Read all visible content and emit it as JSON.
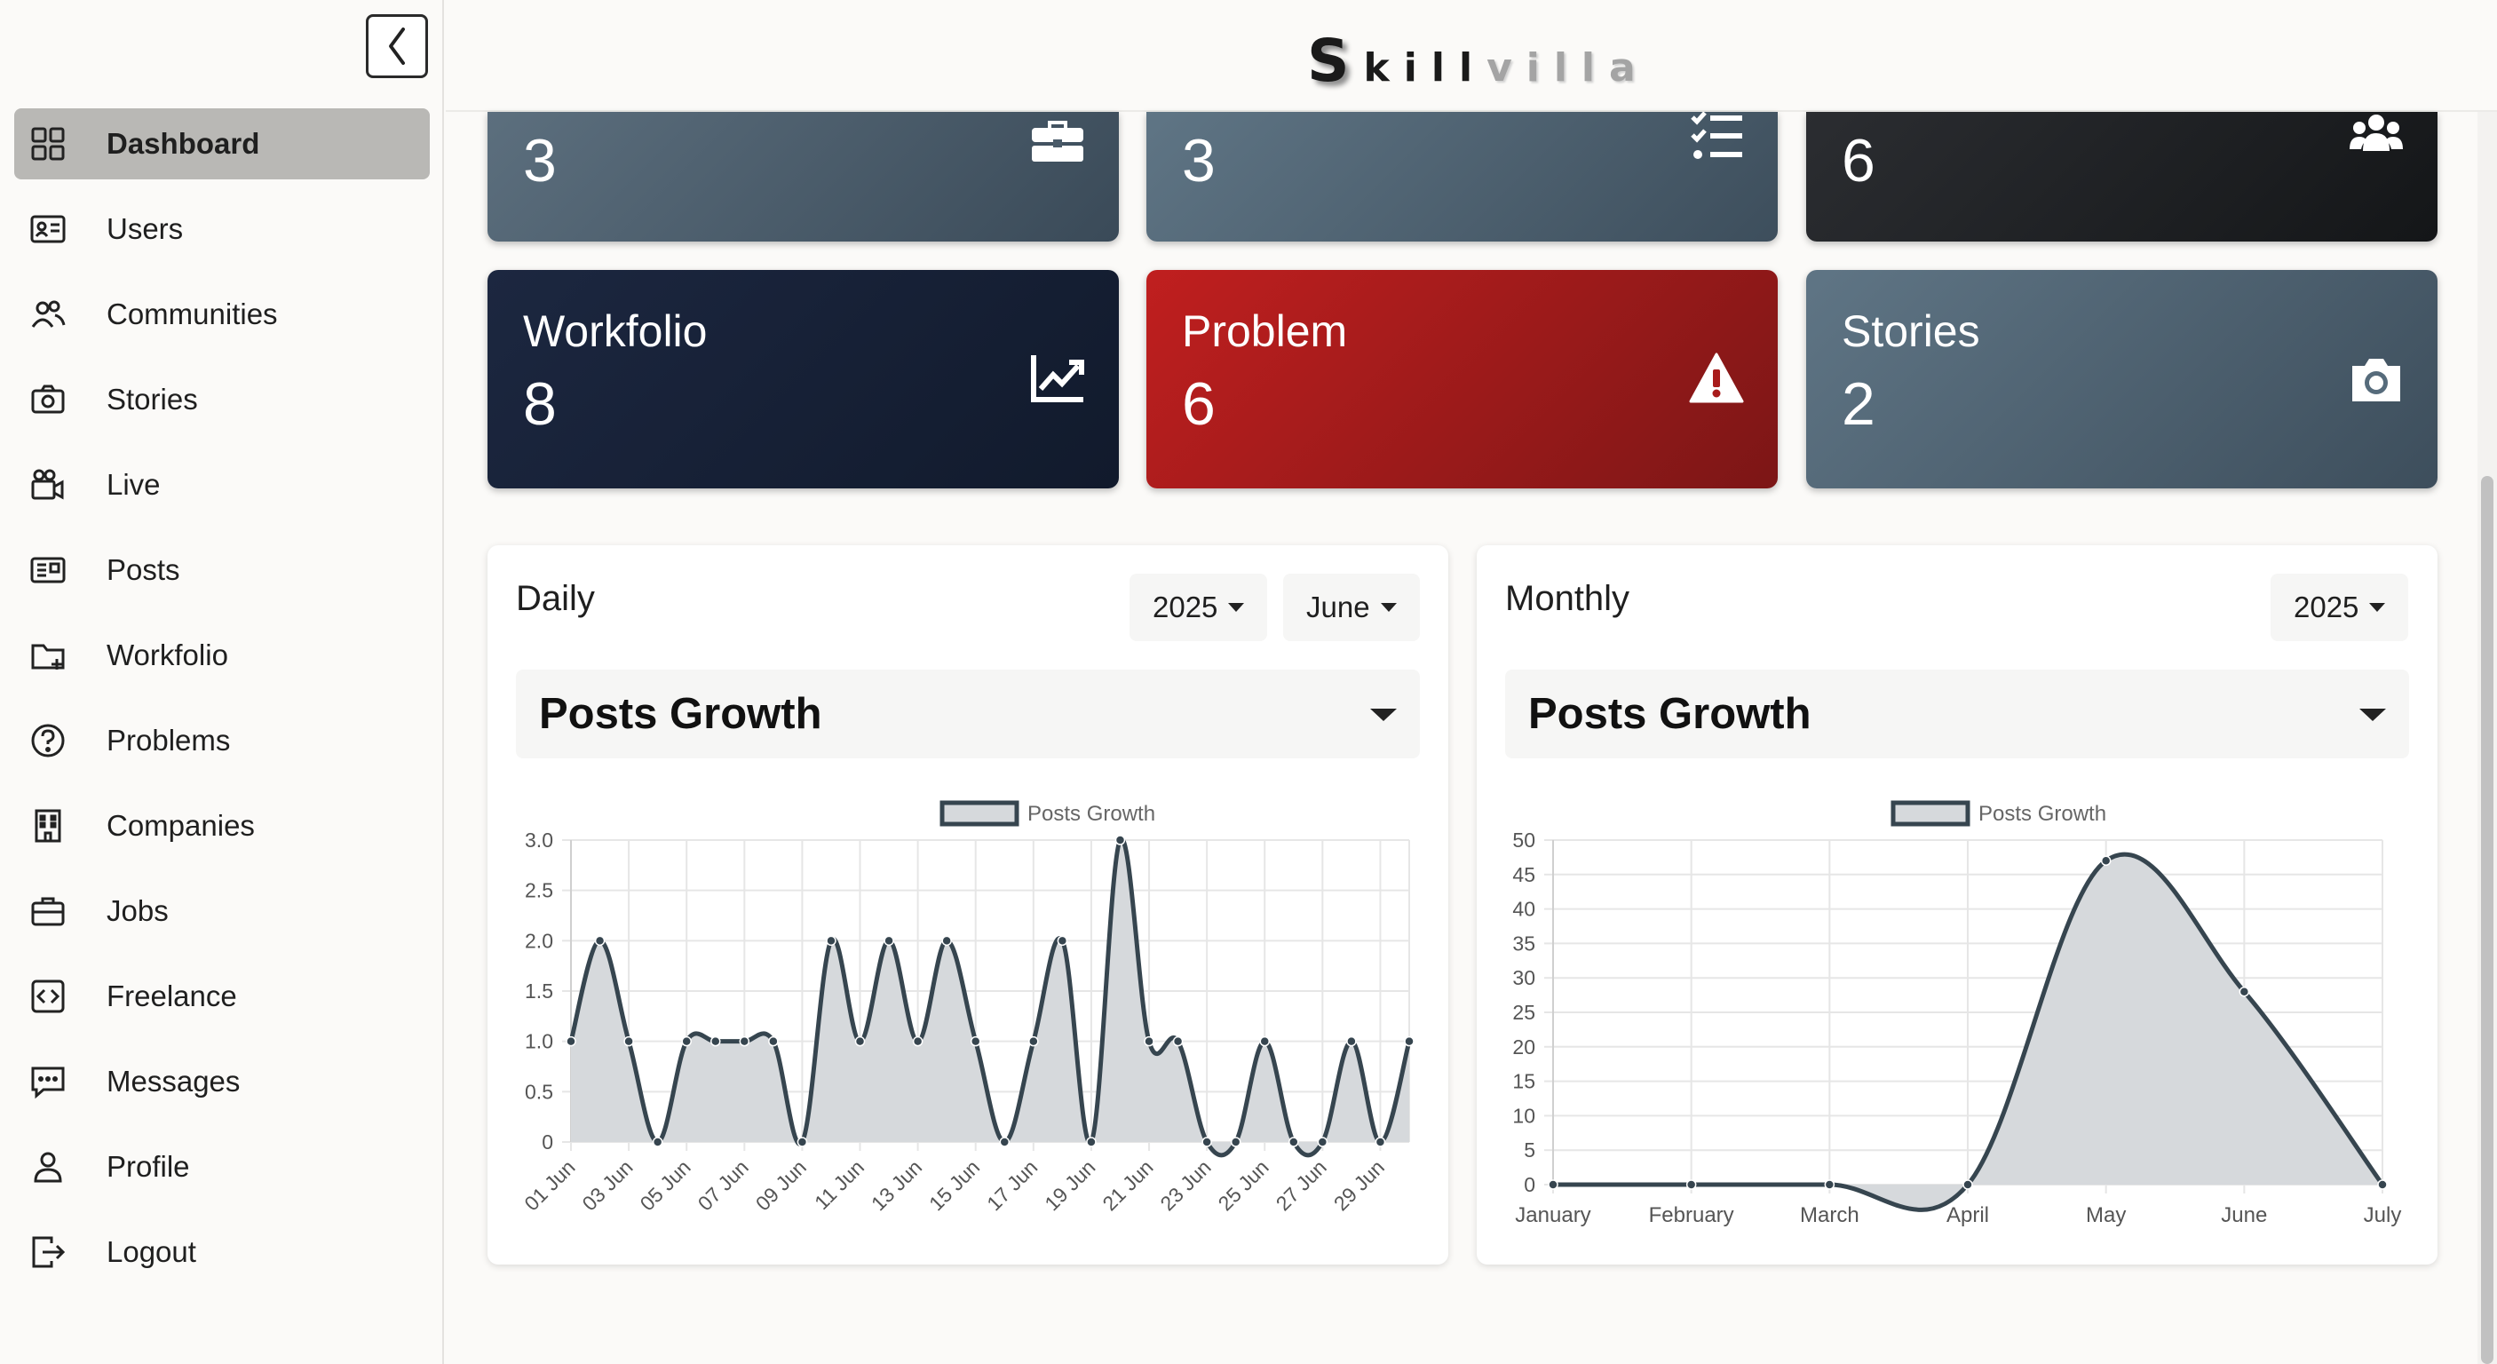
{
  "brand": {
    "initial": "S",
    "dark_part": "kill",
    "light_part": "villa"
  },
  "sidebar": {
    "items": [
      {
        "label": "Dashboard",
        "icon": "dashboard-icon",
        "active": true
      },
      {
        "label": "Users",
        "icon": "users-id-card-icon"
      },
      {
        "label": "Communities",
        "icon": "communities-icon"
      },
      {
        "label": "Stories",
        "icon": "camera-icon"
      },
      {
        "label": "Live",
        "icon": "video-camera-icon"
      },
      {
        "label": "Posts",
        "icon": "posts-icon"
      },
      {
        "label": "Workfolio",
        "icon": "folder-plus-icon"
      },
      {
        "label": "Problems",
        "icon": "question-circle-icon"
      },
      {
        "label": "Companies",
        "icon": "building-icon"
      },
      {
        "label": "Jobs",
        "icon": "briefcase-icon"
      },
      {
        "label": "Freelance",
        "icon": "code-icon"
      },
      {
        "label": "Messages",
        "icon": "message-icon"
      },
      {
        "label": "Profile",
        "icon": "person-icon"
      },
      {
        "label": "Logout",
        "icon": "logout-icon"
      }
    ]
  },
  "cards": {
    "top": [
      {
        "value": "3",
        "icon": "briefcase-icon"
      },
      {
        "value": "3",
        "icon": "checklist-icon"
      },
      {
        "value": "6",
        "icon": "users-group-icon"
      }
    ],
    "bottom": [
      {
        "label": "Workfolio",
        "value": "8",
        "icon": "chart-line-icon"
      },
      {
        "label": "Problem",
        "value": "6",
        "icon": "warning-icon"
      },
      {
        "label": "Stories",
        "value": "2",
        "icon": "camera-icon"
      }
    ]
  },
  "daily": {
    "title": "Daily",
    "year": "2025",
    "month": "June",
    "metric": "Posts Growth"
  },
  "monthly": {
    "title": "Monthly",
    "year": "2025",
    "metric": "Posts Growth"
  },
  "colors": {
    "series_line": "#36454f",
    "series_fill": "#d6d9dc",
    "grid": "#e6e6e6"
  },
  "chart_data": [
    {
      "type": "area",
      "legend": "Posts Growth",
      "x": [
        "01 Jun",
        "02 Jun",
        "03 Jun",
        "04 Jun",
        "05 Jun",
        "06 Jun",
        "07 Jun",
        "08 Jun",
        "09 Jun",
        "10 Jun",
        "11 Jun",
        "12 Jun",
        "13 Jun",
        "14 Jun",
        "15 Jun",
        "16 Jun",
        "17 Jun",
        "18 Jun",
        "19 Jun",
        "20 Jun",
        "21 Jun",
        "22 Jun",
        "23 Jun",
        "24 Jun",
        "25 Jun",
        "26 Jun",
        "27 Jun",
        "28 Jun",
        "29 Jun",
        "30 Jun"
      ],
      "tick_labels": [
        "01 Jun",
        "03 Jun",
        "05 Jun",
        "07 Jun",
        "09 Jun",
        "11 Jun",
        "13 Jun",
        "15 Jun",
        "17 Jun",
        "19 Jun",
        "21 Jun",
        "23 Jun",
        "25 Jun",
        "27 Jun",
        "29 Jun"
      ],
      "series": [
        {
          "name": "Posts Growth",
          "values": [
            1,
            2,
            1,
            0,
            1,
            1,
            1,
            1,
            0,
            2,
            1,
            2,
            1,
            2,
            1,
            0,
            1,
            2,
            0,
            3,
            1,
            1,
            0,
            0,
            1,
            0,
            0,
            1,
            0,
            1
          ]
        }
      ],
      "y_ticks": [
        "0",
        "0.5",
        "1.0",
        "1.5",
        "2.0",
        "2.5",
        "3.0"
      ],
      "ylim": [
        0,
        3
      ],
      "grid": true,
      "legend_position": "top"
    },
    {
      "type": "area",
      "legend": "Posts Growth",
      "x": [
        "January",
        "February",
        "March",
        "April",
        "May",
        "June",
        "July"
      ],
      "series": [
        {
          "name": "Posts Growth",
          "values": [
            0,
            0,
            0,
            0,
            47,
            28,
            0
          ]
        }
      ],
      "y_ticks": [
        "0",
        "5",
        "10",
        "15",
        "20",
        "25",
        "30",
        "35",
        "40",
        "45",
        "50"
      ],
      "ylim": [
        0,
        50
      ],
      "grid": true,
      "legend_position": "top"
    }
  ]
}
